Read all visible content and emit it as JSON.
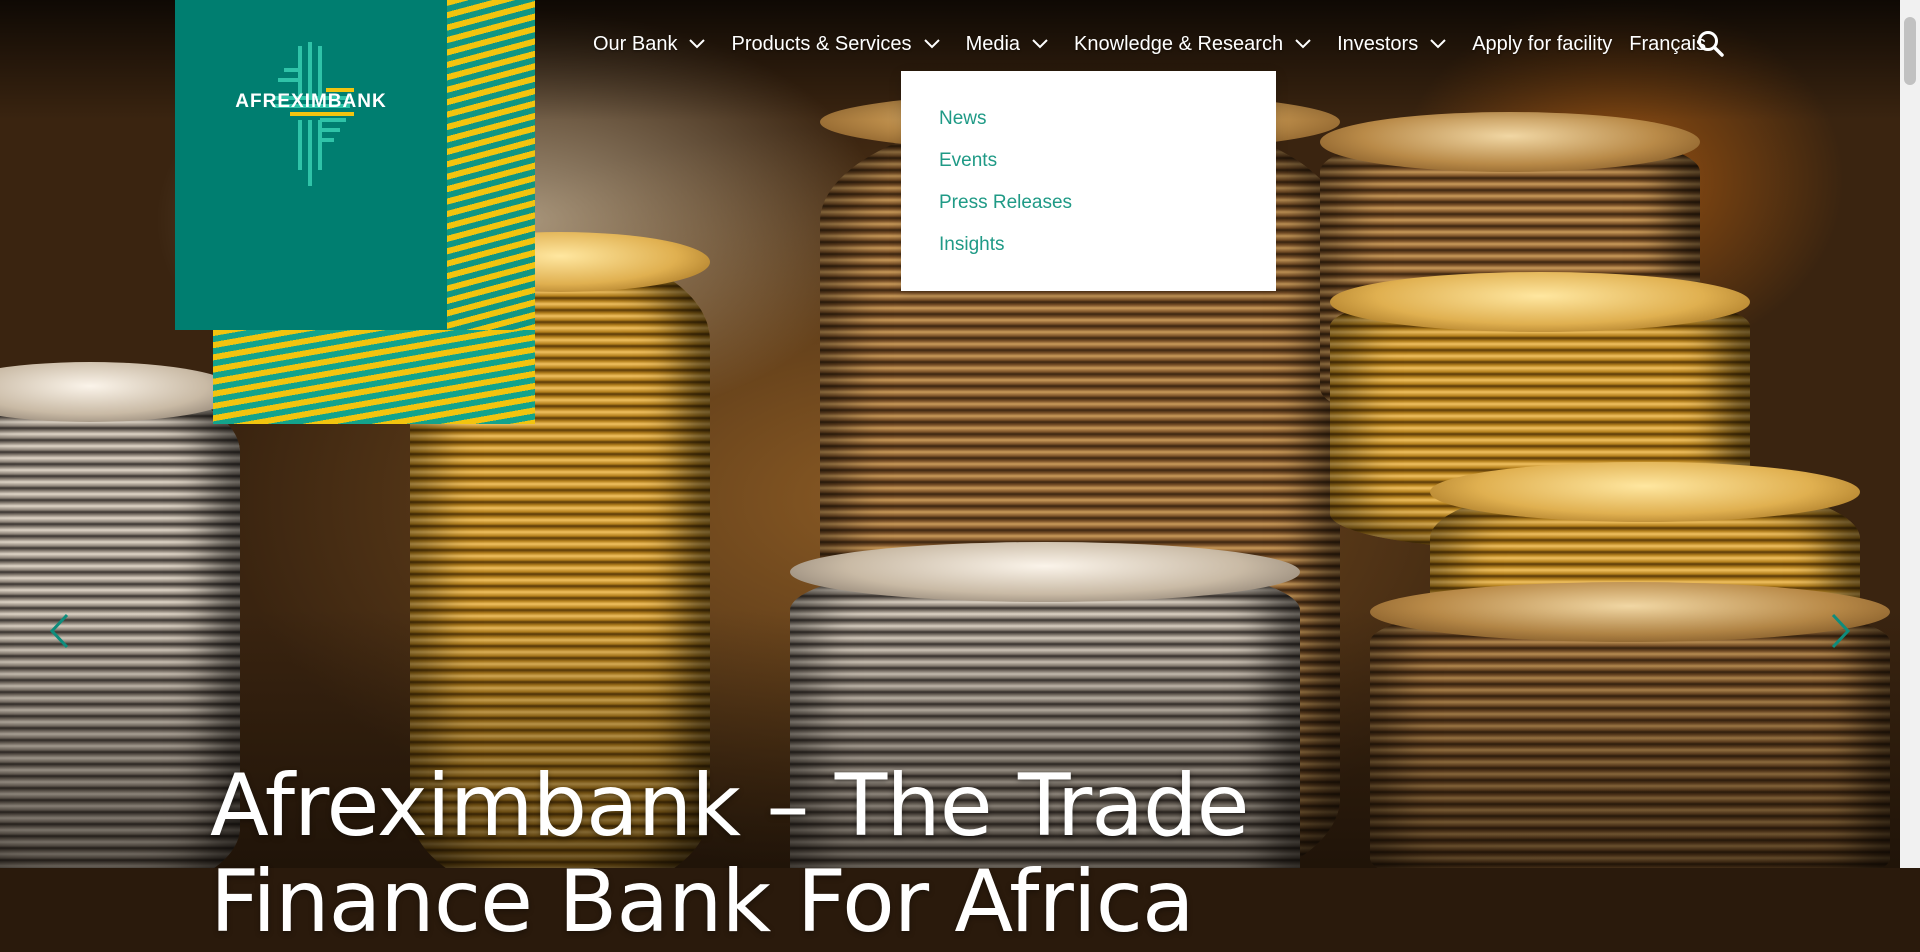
{
  "brand": {
    "name": "AFREXIMBANK",
    "colors": {
      "teal": "#007e70",
      "yellow": "#f2c40f",
      "dropdown_text": "#1f9a86"
    }
  },
  "nav": {
    "items": [
      {
        "label": "Our Bank",
        "has_dropdown": true
      },
      {
        "label": "Products & Services",
        "has_dropdown": true
      },
      {
        "label": "Media",
        "has_dropdown": true
      },
      {
        "label": "Knowledge & Research",
        "has_dropdown": true
      },
      {
        "label": "Investors",
        "has_dropdown": true
      },
      {
        "label": "Apply for facility",
        "has_dropdown": false
      },
      {
        "label": "Français",
        "has_dropdown": false
      }
    ],
    "search_icon": "search-icon"
  },
  "media_menu": {
    "items": [
      "News",
      "Events",
      "Press Releases",
      "Insights"
    ]
  },
  "hero": {
    "headline": "Afreximbank – The Trade Finance Bank For Africa",
    "prev_icon": "chevron-left-icon",
    "next_icon": "chevron-right-icon"
  }
}
